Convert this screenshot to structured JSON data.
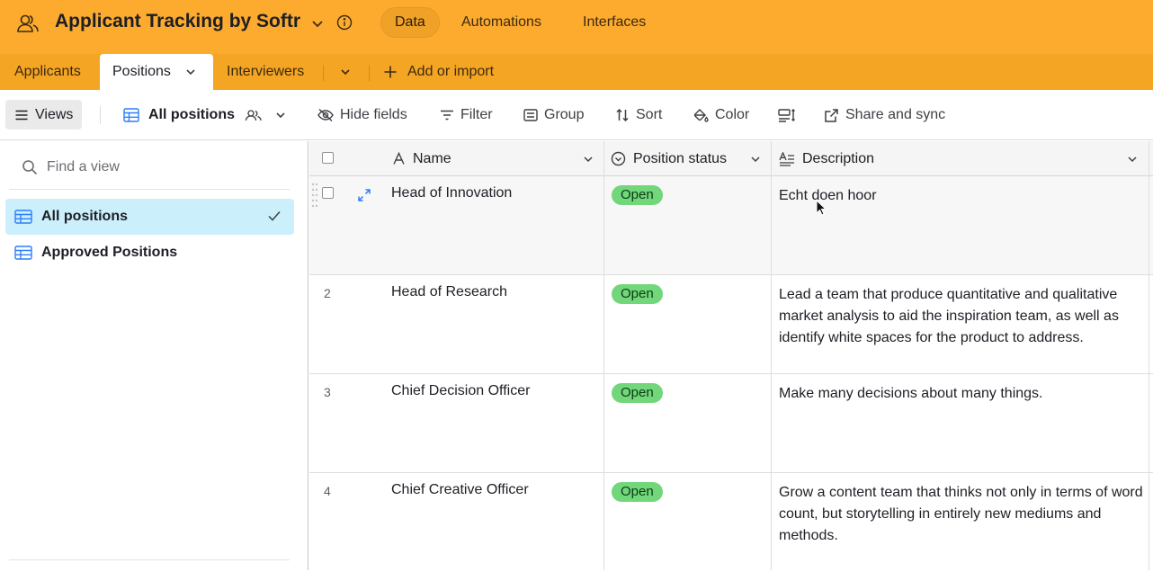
{
  "base": {
    "title": "Applicant Tracking by Softr"
  },
  "top_nav": [
    {
      "label": "Data",
      "active": true
    },
    {
      "label": "Automations",
      "active": false
    },
    {
      "label": "Interfaces",
      "active": false
    }
  ],
  "tabs": [
    {
      "label": "Applicants",
      "active": false
    },
    {
      "label": "Positions",
      "active": true
    },
    {
      "label": "Interviewers",
      "active": false
    }
  ],
  "add_import_label": "Add or import",
  "toolbar": {
    "views_label": "Views",
    "current_view": "All positions",
    "hide_fields": "Hide fields",
    "filter": "Filter",
    "group": "Group",
    "sort": "Sort",
    "color": "Color",
    "share_sync": "Share and sync"
  },
  "sidebar": {
    "search_placeholder": "Find a view",
    "views": [
      {
        "label": "All positions",
        "active": true
      },
      {
        "label": "Approved Positions",
        "active": false
      }
    ]
  },
  "grid": {
    "columns": [
      "Name",
      "Position status",
      "Description"
    ],
    "rows": [
      {
        "num": "",
        "name": "Head of Innovation",
        "status": "Open",
        "description": "Echt doen hoor"
      },
      {
        "num": "2",
        "name": "Head of Research",
        "status": "Open",
        "description": "Lead a team that produce quantitative and qualitative market analysis to aid the inspiration team, as well as identify white spaces for the product to address."
      },
      {
        "num": "3",
        "name": "Chief Decision Officer",
        "status": "Open",
        "description": "Make many decisions about many things."
      },
      {
        "num": "4",
        "name": "Chief Creative Officer",
        "status": "Open",
        "description": "Grow a content team that thinks not only in terms of word count, but storytelling in entirely new mediums and methods."
      }
    ]
  },
  "colors": {
    "topbar": "#fdab2f",
    "tabbar": "#f5a524",
    "status_open": "#72d67b",
    "active_view": "#cceffc"
  }
}
